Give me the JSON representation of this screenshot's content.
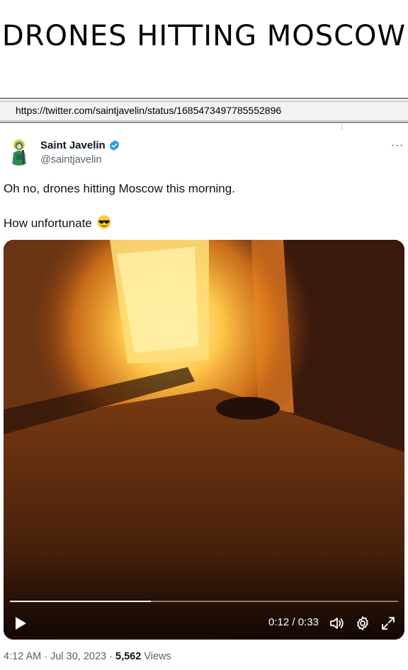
{
  "headline": "DRONES HITTING MOSCOW",
  "url": "https://twitter.com/saintjavelin/status/1685473497785552896",
  "tweet": {
    "author_name": "Saint Javelin",
    "author_handle": "@saintjavelin",
    "more_label": "···",
    "line1": "Oh no, drones hitting Moscow this morning.",
    "line2": "How unfortunate",
    "emoji": "smiling-face-with-sunglasses"
  },
  "video": {
    "progress_fraction": 0.364,
    "timecode": "0:12 / 0:33"
  },
  "meta": {
    "time": "4:12 AM",
    "sep1": " · ",
    "date": "Jul 30, 2023",
    "sep2": " · ",
    "views_count": "5,562",
    "views_label": " Views"
  },
  "colors": {
    "verified": "#1d9bf0",
    "handle": "#536471",
    "fire": "#ffc84a"
  }
}
